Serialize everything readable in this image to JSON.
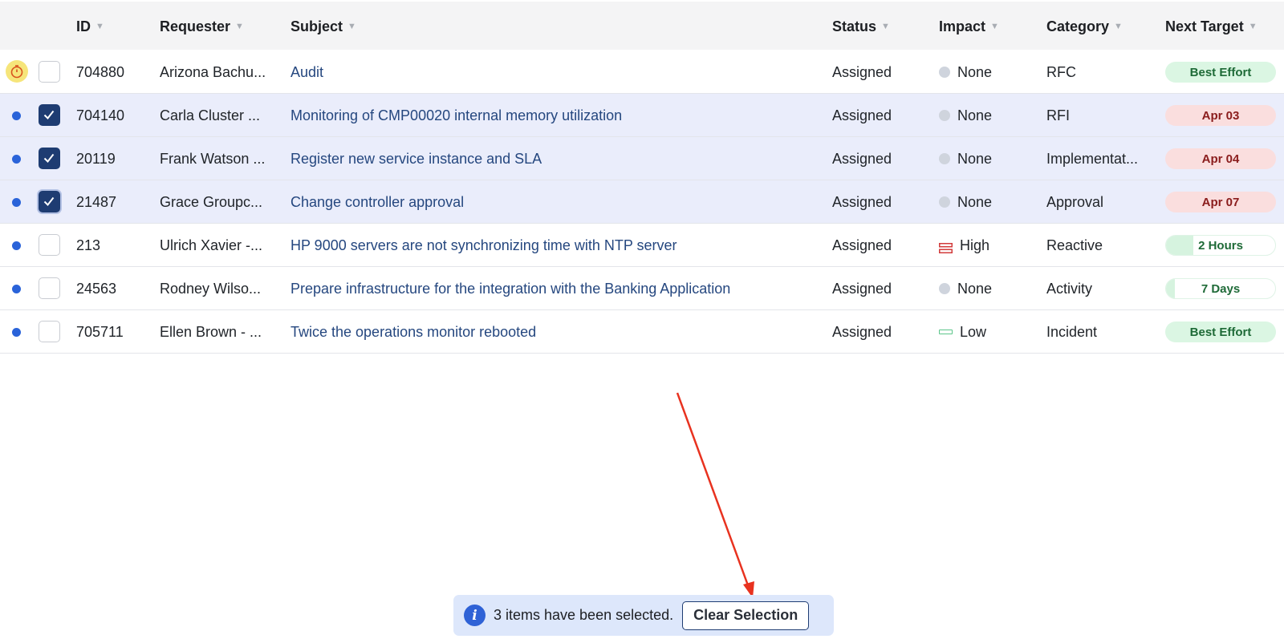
{
  "columns": {
    "id": "ID",
    "requester": "Requester",
    "subject": "Subject",
    "status": "Status",
    "impact": "Impact",
    "category": "Category",
    "next_target": "Next Target"
  },
  "rows": [
    {
      "id": "704880",
      "requester": "Arizona Bachu...",
      "subject": "Audit",
      "status": "Assigned",
      "impact": "None",
      "category": "RFC",
      "next_target": "Best Effort",
      "selected": false
    },
    {
      "id": "704140",
      "requester": "Carla Cluster ...",
      "subject": "Monitoring of CMP00020 internal memory utilization",
      "status": "Assigned",
      "impact": "None",
      "category": "RFI",
      "next_target": "Apr 03",
      "selected": true
    },
    {
      "id": "20119",
      "requester": "Frank Watson ...",
      "subject": "Register new service instance and SLA",
      "status": "Assigned",
      "impact": "None",
      "category": "Implementat...",
      "next_target": "Apr 04",
      "selected": true
    },
    {
      "id": "21487",
      "requester": "Grace Groupc...",
      "subject": "Change controller approval",
      "status": "Assigned",
      "impact": "None",
      "category": "Approval",
      "next_target": "Apr 07",
      "selected": true
    },
    {
      "id": "213",
      "requester": "Ulrich Xavier -...",
      "subject": "HP 9000 servers are not synchronizing time with NTP server",
      "status": "Assigned",
      "impact": "High",
      "category": "Reactive",
      "next_target": "2 Hours",
      "next_target_progress": 0.25,
      "selected": false
    },
    {
      "id": "24563",
      "requester": "Rodney Wilso...",
      "subject": "Prepare infrastructure for the integration with the Banking Application",
      "status": "Assigned",
      "impact": "None",
      "category": "Activity",
      "next_target": "7 Days",
      "next_target_progress": 0.08,
      "selected": false
    },
    {
      "id": "705711",
      "requester": "Ellen Brown - ...",
      "subject": "Twice the operations monitor rebooted",
      "status": "Assigned",
      "impact": "Low",
      "category": "Incident",
      "next_target": "Best Effort",
      "selected": false
    }
  ],
  "toast": {
    "message": "3 items have been selected.",
    "button": "Clear Selection"
  },
  "colors": {
    "accent": "#1e3c72",
    "link": "#25477f",
    "selected_row": "#eaedfb",
    "toast_bg": "#dde7fb",
    "arrow": "#e8321f"
  }
}
